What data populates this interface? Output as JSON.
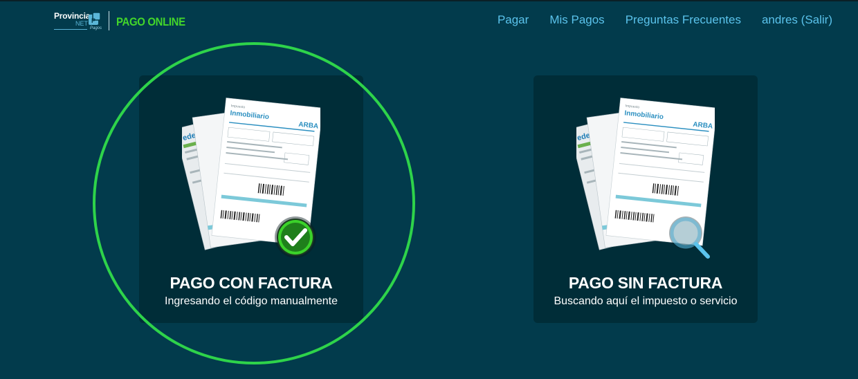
{
  "header": {
    "logo": {
      "provincia": "Provincia",
      "net": "NET",
      "pagos": "Pagos",
      "product": "PAGO ONLINE"
    },
    "nav": [
      {
        "label": "Pagar"
      },
      {
        "label": "Mis Pagos"
      },
      {
        "label": "Preguntas Frecuentes"
      },
      {
        "label": "andres (Salir)"
      }
    ]
  },
  "options": [
    {
      "title": "PAGO CON FACTURA",
      "subtitle": "Ingresando el código manualmente",
      "badge_icon": "check-icon",
      "selected": true
    },
    {
      "title": "PAGO SIN FACTURA",
      "subtitle": "Buscando aquí el impuesto o servicio",
      "badge_icon": "magnifier-icon",
      "selected": false
    }
  ],
  "bill_illustration": {
    "brand_1": "edenor",
    "brand_2": "ARBA",
    "doc_title": "Inmobiliario",
    "doc_header": "Impuesto"
  },
  "colors": {
    "background": "#023b4c",
    "card": "#002d38",
    "nav_link": "#5bc3ec",
    "accent_green": "#43d62a",
    "selection_ring": "#2ed34a",
    "search_badge": "#5bc3ec"
  }
}
